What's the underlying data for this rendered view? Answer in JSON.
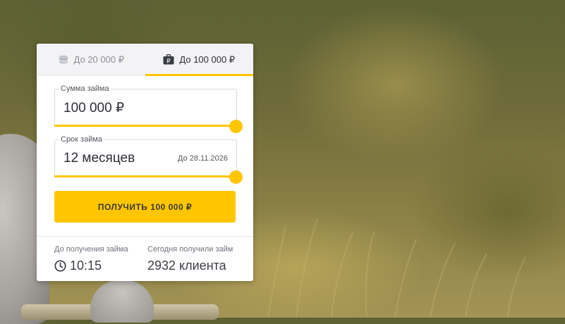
{
  "tabs": [
    {
      "label": "До 20 000 ₽",
      "icon": "coins-stack-icon",
      "active": false
    },
    {
      "label": "До 100 000 ₽",
      "icon": "ruble-briefcase-icon",
      "active": true
    }
  ],
  "amount": {
    "label": "Сумма займа",
    "value": "100 000 ₽",
    "slider_fraction": 1.0
  },
  "term": {
    "label": "Срок займа",
    "value": "12 месяцев",
    "hint": "До 28.11.2026",
    "slider_fraction": 1.0
  },
  "cta": {
    "label": "ПОЛУЧИТЬ 100 000 ₽"
  },
  "stats": {
    "time_label": "До получения займа",
    "time_value": "10:15",
    "time_icon": "clock-icon",
    "clients_label": "Сегодня получили займ",
    "clients_value": "2932 клиента"
  },
  "colors": {
    "accent": "#ffc600",
    "text": "#2d2f38",
    "muted": "#8d8f99"
  }
}
